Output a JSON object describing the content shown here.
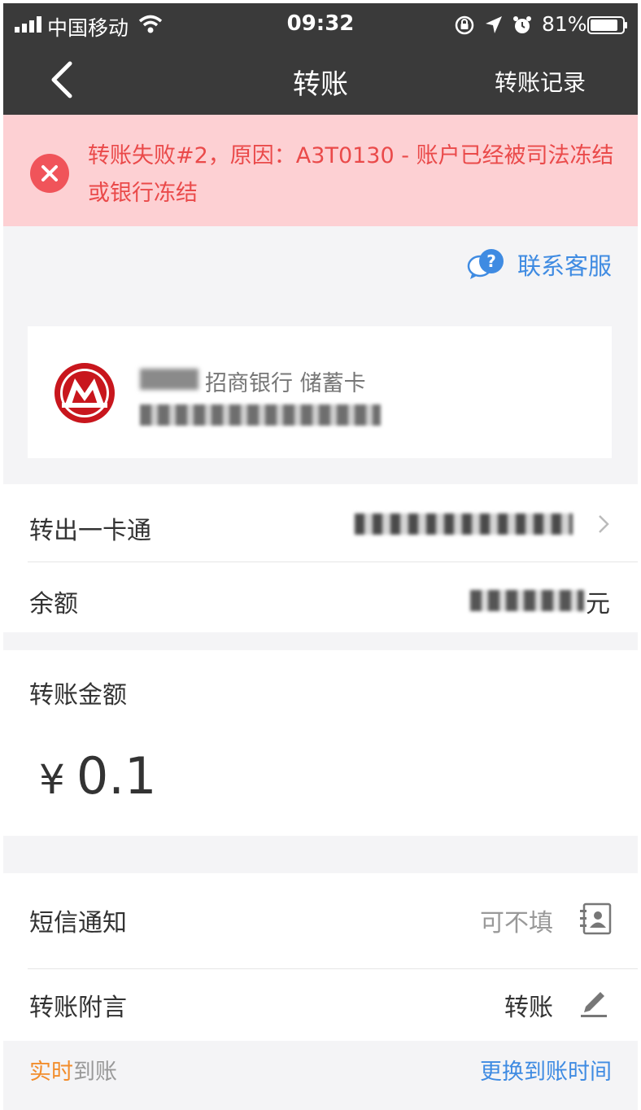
{
  "status_bar": {
    "carrier": "中国移动",
    "time": "09:32",
    "battery": "81%"
  },
  "nav": {
    "title": "转账",
    "right_label": "转账记录"
  },
  "error": {
    "message": "转账失败#2，原因：A3T0130 - 账户已经被司法冻结或银行冻结"
  },
  "service": {
    "label": "联系客服"
  },
  "card": {
    "bank_name": "招商银行 储蓄卡"
  },
  "account": {
    "from_label": "转出一卡通",
    "balance_label": "余额",
    "balance_unit": "元"
  },
  "amount": {
    "label": "转账金额",
    "currency": "¥",
    "value": "0.1"
  },
  "sms": {
    "label": "短信通知",
    "placeholder": "可不填"
  },
  "memo": {
    "label": "转账附言",
    "value": "转账"
  },
  "footer": {
    "arrive_highlight": "实时",
    "arrive_rest": "到账",
    "change_label": "更换到账时间"
  },
  "colors": {
    "nav_bg": "#3a3a3a",
    "error_bg": "#fdd0d3",
    "error_text": "#ea4a4a",
    "link_blue": "#3f8be2",
    "highlight_orange": "#f28d2c",
    "bank_red": "#c8161d"
  }
}
